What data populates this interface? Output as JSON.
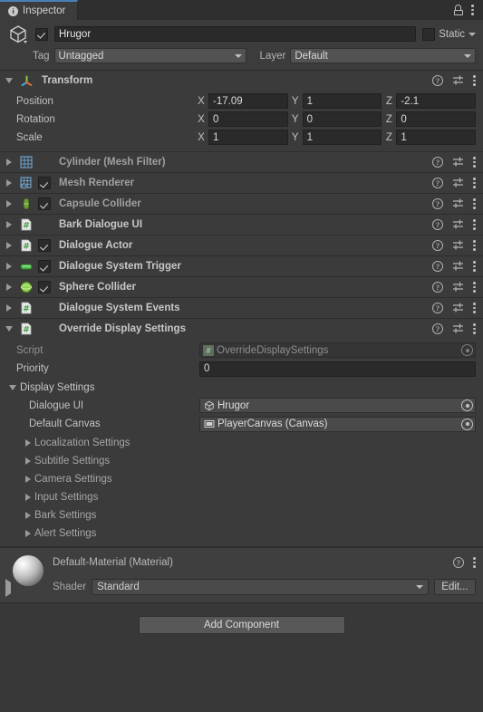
{
  "tab": {
    "label": "Inspector",
    "info_icon": "info-icon",
    "lock_icon": "lock-icon",
    "menu_icon": "kebab-menu-icon"
  },
  "gameobject": {
    "icon": "cube-icon",
    "enabled": true,
    "name": "Hrugor",
    "static_label": "Static",
    "static_checked": false,
    "tag_label": "Tag",
    "tag_value": "Untagged",
    "layer_label": "Layer",
    "layer_value": "Default"
  },
  "transform": {
    "title": "Transform",
    "icon": "transform-gizmo-icon",
    "expanded": true,
    "rows": [
      {
        "label": "Position",
        "x": "-17.09",
        "y": "1",
        "z": "-2.1"
      },
      {
        "label": "Rotation",
        "x": "0",
        "y": "0",
        "z": "0"
      },
      {
        "label": "Scale",
        "x": "1",
        "y": "1",
        "z": "1"
      }
    ],
    "axis_labels": {
      "x": "X",
      "y": "Y",
      "z": "Z"
    }
  },
  "components": [
    {
      "title": "Cylinder (Mesh Filter)",
      "icon": "mesh-filter-icon",
      "has_checkbox": false,
      "enabled": false,
      "dim": true,
      "expanded": false
    },
    {
      "title": "Mesh Renderer",
      "icon": "mesh-renderer-icon",
      "has_checkbox": true,
      "enabled": true,
      "dim": true,
      "expanded": false
    },
    {
      "title": "Capsule Collider",
      "icon": "capsule-collider-icon",
      "has_checkbox": true,
      "enabled": true,
      "dim": true,
      "expanded": false
    },
    {
      "title": "Bark Dialogue UI",
      "icon": "script-icon",
      "has_checkbox": false,
      "enabled": false,
      "dim": false,
      "expanded": false
    },
    {
      "title": "Dialogue Actor",
      "icon": "script-icon",
      "has_checkbox": true,
      "enabled": true,
      "dim": false,
      "expanded": false
    },
    {
      "title": "Dialogue System Trigger",
      "icon": "capsule-trigger-icon",
      "has_checkbox": true,
      "enabled": true,
      "dim": false,
      "expanded": false
    },
    {
      "title": "Sphere Collider",
      "icon": "sphere-collider-icon",
      "has_checkbox": true,
      "enabled": true,
      "dim": false,
      "expanded": false
    },
    {
      "title": "Dialogue System Events",
      "icon": "script-icon",
      "has_checkbox": false,
      "enabled": false,
      "dim": false,
      "expanded": false
    }
  ],
  "override_display_settings": {
    "title": "Override Display Settings",
    "icon": "script-icon",
    "expanded": true,
    "script_label": "Script",
    "script_value": "OverrideDisplaySettings",
    "script_icon": "cs-script-icon",
    "priority_label": "Priority",
    "priority_value": "0",
    "display_settings_label": "Display Settings",
    "dialogue_ui_label": "Dialogue UI",
    "dialogue_ui_value": "Hrugor",
    "dialogue_ui_icon": "prefab-cube-icon",
    "default_canvas_label": "Default Canvas",
    "default_canvas_value": "PlayerCanvas (Canvas)",
    "default_canvas_icon": "canvas-icon",
    "sub_sections": [
      "Localization Settings",
      "Subtitle Settings",
      "Camera Settings",
      "Input Settings",
      "Bark Settings",
      "Alert Settings"
    ]
  },
  "material": {
    "title": "Default-Material (Material)",
    "preview_icon": "material-sphere-preview",
    "shader_label": "Shader",
    "shader_value": "Standard",
    "edit_label": "Edit...",
    "expanded": false
  },
  "add_component": {
    "label": "Add Component"
  },
  "icons": {
    "help": "?",
    "preset": "preset-icon",
    "menu": "kebab-menu-icon"
  },
  "colors": {
    "accent_tab": "#4a7fb5",
    "panel_bg": "#383838",
    "row_bg": "#3b3b3b",
    "field_bg": "#2a2a2a",
    "object_field_bg": "#4a4a4a",
    "green_collider": "#7ac943"
  }
}
